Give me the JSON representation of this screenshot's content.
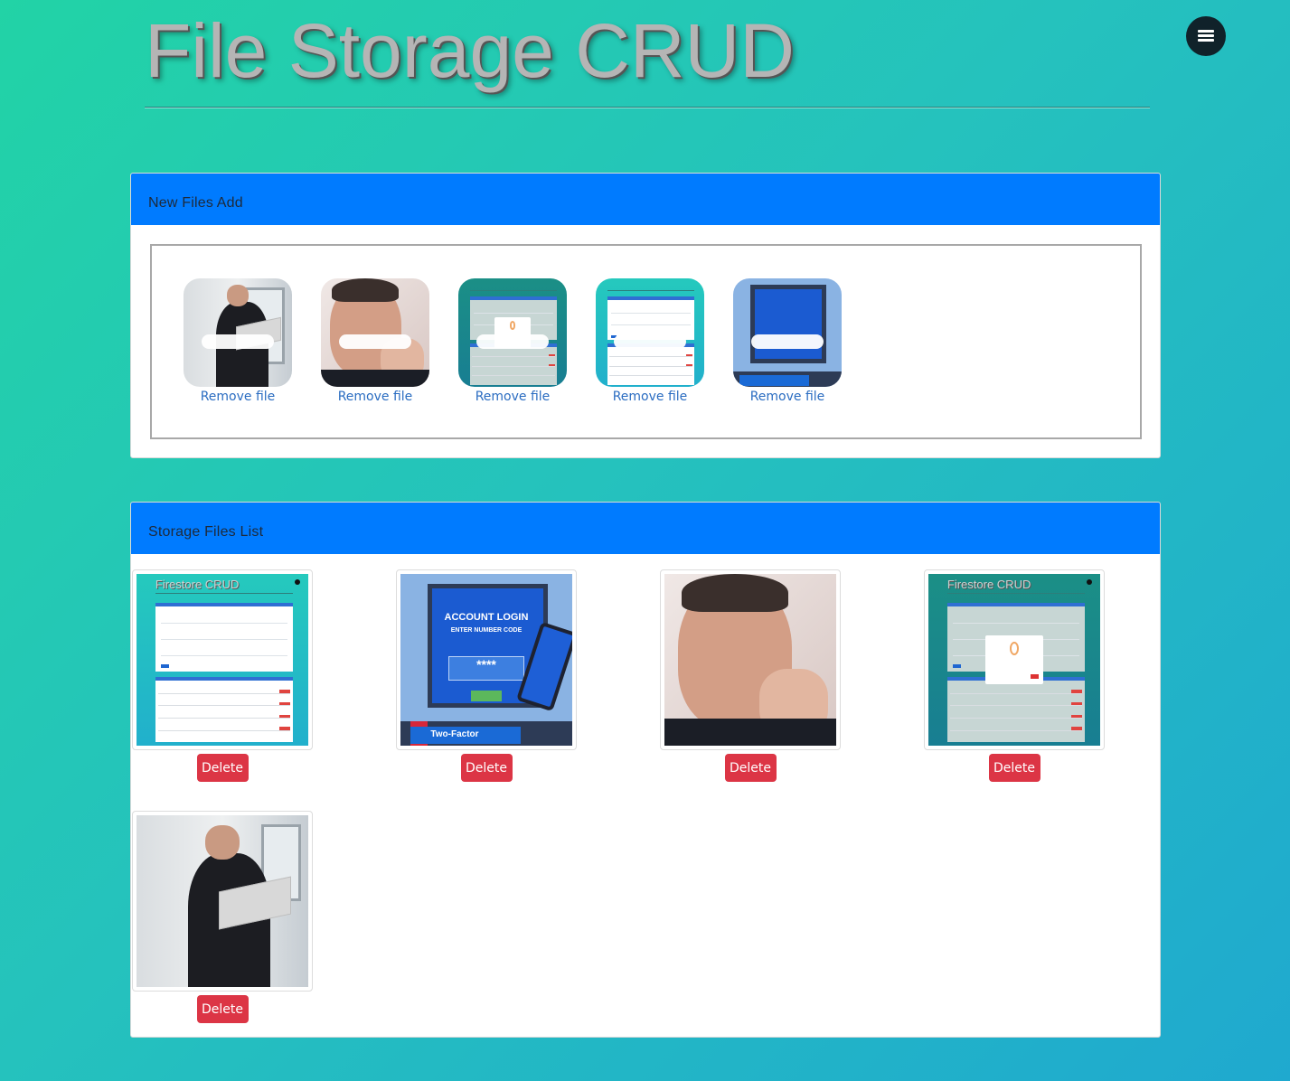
{
  "header": {
    "title": "File Storage CRUD",
    "menu_icon": "hamburger-menu-icon"
  },
  "new_files_card": {
    "title": "New Files Add",
    "items": [
      {
        "image": "businessman-with-laptop",
        "remove_label": "Remove file"
      },
      {
        "image": "man-pointing-finger",
        "remove_label": "Remove file"
      },
      {
        "image": "firestore-crud-delete-modal",
        "remove_label": "Remove file"
      },
      {
        "image": "firestore-crud-form",
        "remove_label": "Remove file"
      },
      {
        "image": "account-login-two-factor",
        "remove_label": "Remove file"
      }
    ]
  },
  "storage_list_card": {
    "title": "Storage Files List",
    "files": [
      {
        "image": "firestore-crud-form",
        "image_caption": "Firestore CRUD",
        "delete_label": "Delete"
      },
      {
        "image": "account-login-two-factor",
        "image_caption": "ACCOUNT LOGIN",
        "image_subcaption": "ENTER NUMBER CODE",
        "image_code": "****",
        "image_footer": "Two-Factor Authentication",
        "delete_label": "Delete"
      },
      {
        "image": "man-pointing-finger",
        "delete_label": "Delete"
      },
      {
        "image": "firestore-crud-delete-modal",
        "image_caption": "Firestore CRUD",
        "delete_label": "Delete"
      },
      {
        "image": "businessman-with-laptop",
        "delete_label": "Delete"
      }
    ]
  },
  "colors": {
    "header_blue": "#007bff",
    "delete_red": "#dc3545",
    "link_blue": "#2a6cc1",
    "background_start": "#22d3a6",
    "background_end": "#1fa9cf"
  }
}
